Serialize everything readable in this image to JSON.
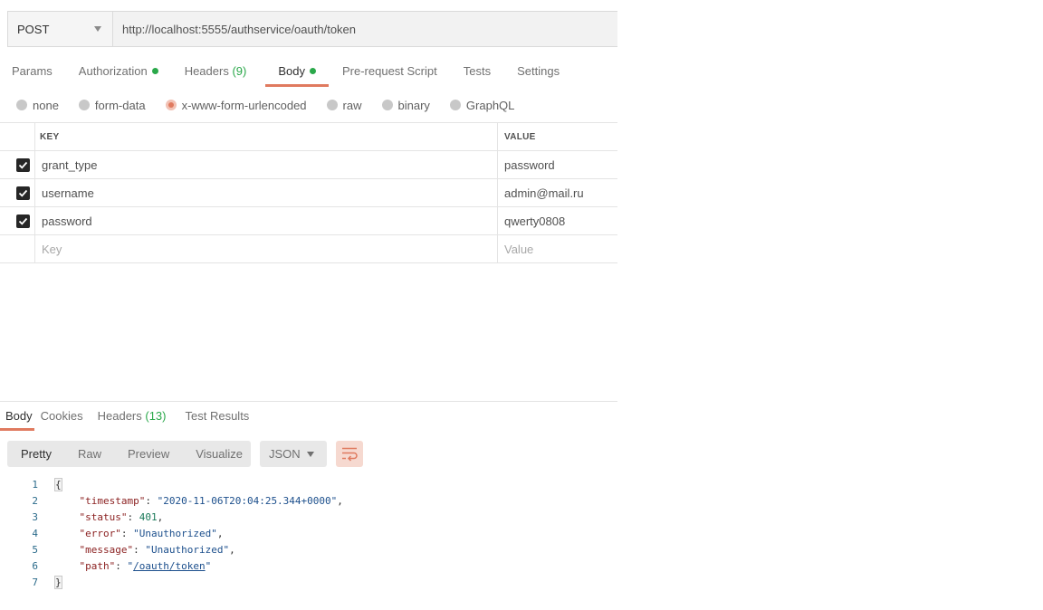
{
  "request": {
    "method": "POST",
    "url": "http://localhost:5555/authservice/oauth/token"
  },
  "tabs": [
    {
      "label": "Params"
    },
    {
      "label": "Authorization",
      "dot": true
    },
    {
      "label": "Headers",
      "count": "(9)"
    },
    {
      "label": "Body",
      "dot": true,
      "active": true
    },
    {
      "label": "Pre-request Script"
    },
    {
      "label": "Tests"
    },
    {
      "label": "Settings"
    }
  ],
  "body_types": [
    {
      "label": "none"
    },
    {
      "label": "form-data"
    },
    {
      "label": "x-www-form-urlencoded",
      "selected": true
    },
    {
      "label": "raw"
    },
    {
      "label": "binary"
    },
    {
      "label": "GraphQL"
    }
  ],
  "params_table": {
    "headers": {
      "key": "KEY",
      "value": "VALUE"
    },
    "rows": [
      {
        "key": "grant_type",
        "value": "password",
        "checked": true
      },
      {
        "key": "username",
        "value": "admin@mail.ru",
        "checked": true
      },
      {
        "key": "password",
        "value": "qwerty0808",
        "checked": true
      }
    ],
    "placeholder": {
      "key": "Key",
      "value": "Value"
    }
  },
  "response": {
    "tabs": [
      {
        "label": "Body",
        "active": true
      },
      {
        "label": "Cookies"
      },
      {
        "label": "Headers",
        "count": "(13)"
      },
      {
        "label": "Test Results"
      }
    ],
    "view_modes": [
      "Pretty",
      "Raw",
      "Preview",
      "Visualize"
    ],
    "format": "JSON",
    "lines": [
      {
        "num": "1",
        "parts": [
          [
            "br",
            "{"
          ]
        ]
      },
      {
        "num": "2",
        "parts": [
          [
            "p",
            "    "
          ],
          [
            "k",
            "\"timestamp\""
          ],
          [
            "p",
            ": "
          ],
          [
            "s",
            "\"2020-11-06T20:04:25.344+0000\""
          ],
          [
            "p",
            ","
          ]
        ]
      },
      {
        "num": "3",
        "parts": [
          [
            "p",
            "    "
          ],
          [
            "k",
            "\"status\""
          ],
          [
            "p",
            ": "
          ],
          [
            "n",
            "401"
          ],
          [
            "p",
            ","
          ]
        ]
      },
      {
        "num": "4",
        "parts": [
          [
            "p",
            "    "
          ],
          [
            "k",
            "\"error\""
          ],
          [
            "p",
            ": "
          ],
          [
            "s",
            "\"Unauthorized\""
          ],
          [
            "p",
            ","
          ]
        ]
      },
      {
        "num": "5",
        "parts": [
          [
            "p",
            "    "
          ],
          [
            "k",
            "\"message\""
          ],
          [
            "p",
            ": "
          ],
          [
            "s",
            "\"Unauthorized\""
          ],
          [
            "p",
            ","
          ]
        ]
      },
      {
        "num": "6",
        "parts": [
          [
            "p",
            "    "
          ],
          [
            "k",
            "\"path\""
          ],
          [
            "p",
            ": "
          ],
          [
            "s",
            "\""
          ],
          [
            "link",
            "/oauth/token"
          ],
          [
            "s",
            "\""
          ]
        ]
      },
      {
        "num": "7",
        "parts": [
          [
            "br",
            "}"
          ]
        ]
      }
    ]
  },
  "colors": {
    "accent": "#e07a5f",
    "status_dot": "#2aa84a"
  }
}
